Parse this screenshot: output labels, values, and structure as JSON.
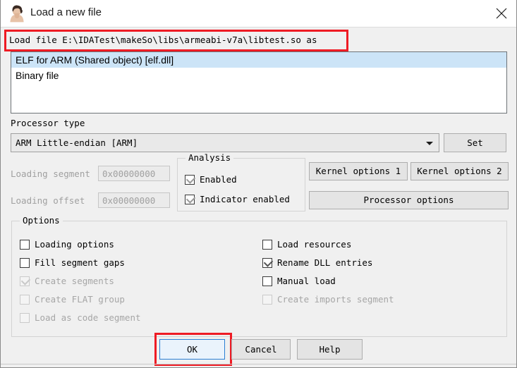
{
  "window": {
    "title": "Load a new file",
    "icon": "ida-woman-icon",
    "close_label": "✕"
  },
  "load_file": {
    "label": "Load file E:\\IDATest\\makeSo\\libs\\armeabi-v7a\\libtest.so as"
  },
  "format_list": {
    "items": [
      {
        "label": "ELF for ARM (Shared object) [elf.dll]",
        "selected": true
      },
      {
        "label": "Binary file",
        "selected": false
      }
    ]
  },
  "processor": {
    "group_label": "Processor type",
    "selected": "ARM Little-endian [ARM]",
    "set_button": "Set"
  },
  "loading": {
    "segment_label": "Loading segment",
    "segment_value": "0x00000000",
    "offset_label": "Loading offset",
    "offset_value": "0x00000000"
  },
  "analysis": {
    "group_label": "Analysis",
    "enabled_label": "Enabled",
    "enabled_checked": true,
    "indicator_label": "Indicator enabled",
    "indicator_checked": true
  },
  "side_buttons": {
    "kernel_options_1": "Kernel options 1",
    "kernel_options_2": "Kernel options 2",
    "processor_options": "Processor options"
  },
  "options": {
    "group_label": "Options",
    "left_column": [
      {
        "label": "Loading options",
        "checked": false,
        "disabled": false
      },
      {
        "label": "Fill segment gaps",
        "checked": false,
        "disabled": false
      },
      {
        "label": "Create segments",
        "checked": true,
        "disabled": true
      },
      {
        "label": "Create FLAT group",
        "checked": false,
        "disabled": true
      },
      {
        "label": "Load as code segment",
        "checked": false,
        "disabled": true
      }
    ],
    "right_column": [
      {
        "label": "Load resources",
        "checked": false,
        "disabled": false
      },
      {
        "label": "Rename DLL entries",
        "checked": true,
        "disabled": false
      },
      {
        "label": "Manual load",
        "checked": false,
        "disabled": false
      },
      {
        "label": "Create imports segment",
        "checked": false,
        "disabled": true
      }
    ]
  },
  "footer": {
    "ok": "OK",
    "cancel": "Cancel",
    "help": "Help"
  },
  "annotations": {
    "color": "#ee1b24",
    "highlighted": [
      "load-file-path",
      "ok-button"
    ]
  }
}
